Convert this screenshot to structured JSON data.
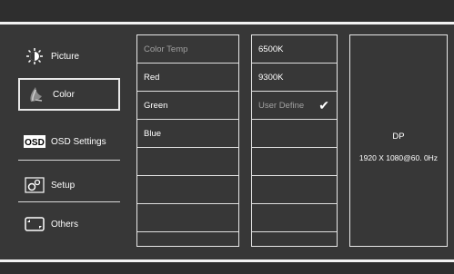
{
  "sidebar": {
    "items": [
      {
        "label": "Picture",
        "icon": "brightness-icon"
      },
      {
        "label": "Color",
        "icon": "color-palette-icon"
      },
      {
        "label": "OSD Settings",
        "icon": "osd-icon"
      },
      {
        "label": "Setup",
        "icon": "gears-icon"
      },
      {
        "label": "Others",
        "icon": "swap-arrows-icon"
      }
    ],
    "selected": "Color"
  },
  "color_menu": {
    "items": [
      "Color Temp",
      "Red",
      "Green",
      "Blue"
    ],
    "active": "Color Temp"
  },
  "color_temp_options": {
    "items": [
      "6500K",
      "9300K",
      "User Define"
    ],
    "checked": "User Define"
  },
  "input_info": {
    "port": "DP",
    "resolution": "1920 X 1080@60. 0Hz"
  }
}
